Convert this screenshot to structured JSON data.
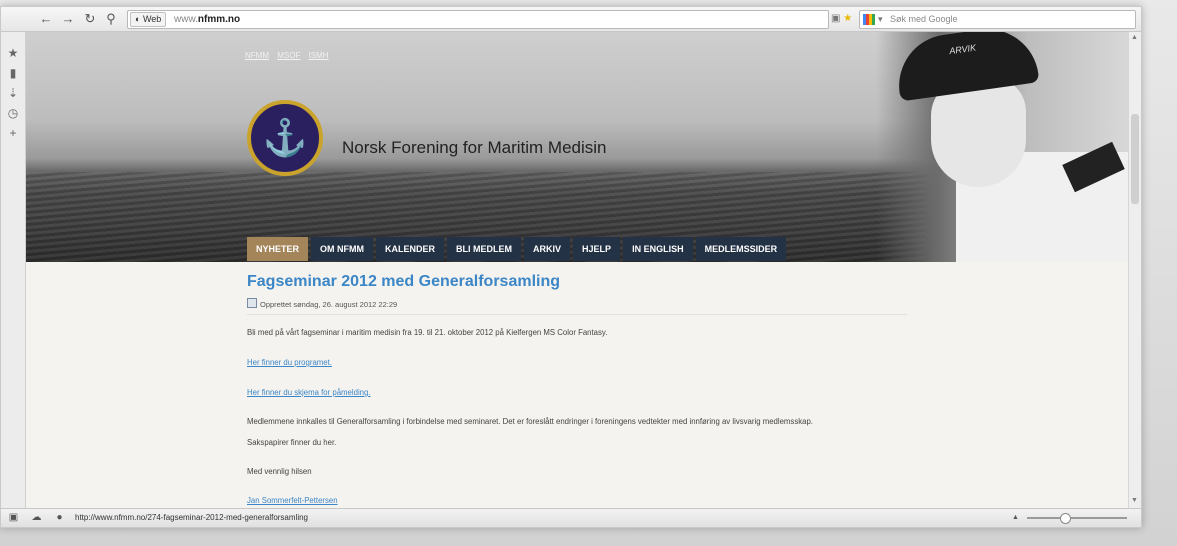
{
  "browser": {
    "address_tag": "Web",
    "url_prefix": "www.",
    "url_domain": "nfmm.no",
    "search_placeholder": "Søk med Google",
    "status_url": "http://www.nfmm.no/274-fagseminar-2012-med-generalforsamling"
  },
  "site": {
    "toplinks": [
      "NFMM",
      "MSOF",
      "ISMH"
    ],
    "name": "Norsk Forening for Maritim Medisin",
    "nav": [
      "NYHETER",
      "OM NFMM",
      "KALENDER",
      "BLI MEDLEM",
      "ARKIV",
      "HJELP",
      "IN ENGLISH",
      "MEDLEMSSIDER"
    ],
    "active_nav": "NYHETER",
    "accent": "#a4855a",
    "nav_color": "#243246"
  },
  "article": {
    "title": "Fagseminar 2012 med Generalforsamling",
    "meta": "Opprettet søndag, 26. august 2012 22:29",
    "intro": "Bli med på vårt fagseminar i maritim medisin fra 19. til 21. oktober 2012 på Kielfergen MS Color Fantasy.",
    "link_program": "Her finner du programet.",
    "link_signup": "Her finner du skjema for påmelding.",
    "body1": "Medlemmene innkalles til Generalforsamling i forbindelse med seminaret. Det er foreslått endringer i foreningens vedtekter med innføring av livsvarig medlemsskap.",
    "body2": "Sakspapirer finner du her.",
    "greeting": "Med vennlig hilsen",
    "signature": "Jan Sommerfelt-Pettersen"
  },
  "cap_text": "ARVIK",
  "link_color": "#3b86c6"
}
